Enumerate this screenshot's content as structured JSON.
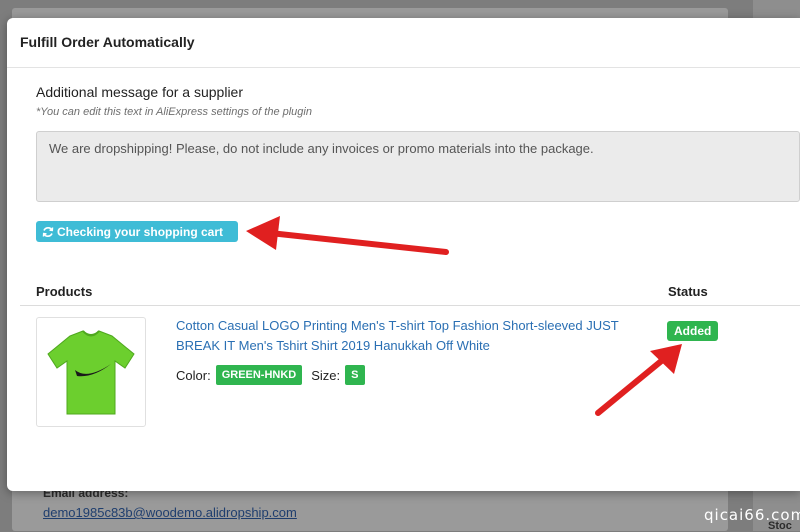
{
  "modal": {
    "title": "Fulfill Order Automatically",
    "message_label": "Additional message for a supplier",
    "message_hint": "*You can edit this text in AliExpress settings of the plugin",
    "message_value": "We are dropshipping! Please, do not include any invoices or promo materials into the package.",
    "check_button_label": "Checking your shopping cart"
  },
  "table": {
    "headers": [
      "Products",
      "Status"
    ],
    "rows": [
      {
        "title": "Cotton Casual LOGO Printing Men's T-shirt Top Fashion Short-sleeved JUST BREAK IT Men's Tshirt Shirt 2019 Hanukkah Off White",
        "color_label": "Color:",
        "color_value": "GREEN-HNKD",
        "size_label": "Size:",
        "size_value": "S",
        "status": "Added"
      }
    ]
  },
  "background": {
    "email_label": "Email address:",
    "email_value": "demo1985c83b@woodemo.alidropship.com",
    "stock_label": "Stoc"
  },
  "watermark": "qicai66.com",
  "colors": {
    "accent_button": "#3fbcd6",
    "status_green": "#2fb54f",
    "link_blue": "#2a6fb3",
    "arrow_red": "#e02020",
    "shirt_green": "#6ccf2e"
  },
  "icons": {
    "refresh": "refresh-icon",
    "annotation": "red-arrow"
  }
}
